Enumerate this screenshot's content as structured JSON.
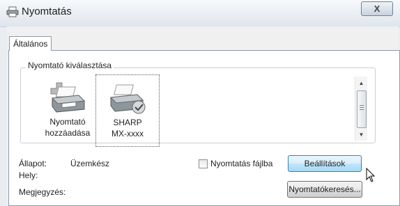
{
  "window": {
    "title": "Nyomtatás",
    "close_glyph": "X"
  },
  "tabs": [
    {
      "label": "Általános",
      "selected": true
    }
  ],
  "printer_group": {
    "label": "Nyomtató kiválasztása",
    "printers": [
      {
        "line1": "Nyomtató",
        "line2": "hozzáadása",
        "icon": "add-printer-icon",
        "selected": false
      },
      {
        "line1": "SHARP",
        "line2": "MX-xxxx",
        "icon": "default-printer-icon",
        "selected": true
      }
    ]
  },
  "status": {
    "status_label": "Állapot:",
    "status_value": "Üzemkész",
    "location_label": "Hely:",
    "comment_label": "Megjegyzés:"
  },
  "print_to_file": {
    "label": "Nyomtatás fájlba",
    "checked": false
  },
  "buttons": {
    "settings": "Beállítások",
    "find_printer": "Nyomtatókeresés..."
  },
  "colors": {
    "titlebar": "#dfe5ec",
    "focus_button": "#bee6fd",
    "panel": "#ffffff"
  }
}
